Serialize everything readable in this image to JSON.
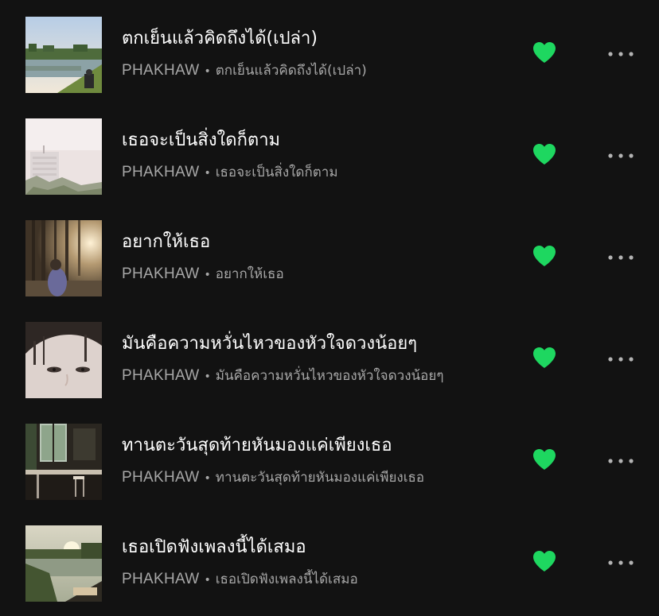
{
  "colors": {
    "background": "#121212",
    "title": "#ffffff",
    "subtitle": "#a7a7a7",
    "liked": "#1ed760",
    "more": "#b3b3b3"
  },
  "icons": {
    "like": "heart-filled-icon",
    "more": "more-options-icon"
  },
  "tracks": [
    {
      "title": "ตกเย็นแล้วคิดถึงได้(เปล่า)",
      "artist": "PHAKHAW",
      "separator": "•",
      "album": "ตกเย็นแล้วคิดถึงได้(เปล่า)",
      "liked": true
    },
    {
      "title": "เธอจะเป็นสิ่งใดก็ตาม",
      "artist": "PHAKHAW",
      "separator": "•",
      "album": "เธอจะเป็นสิ่งใดก็ตาม",
      "liked": true
    },
    {
      "title": "อยากให้เธอ",
      "artist": "PHAKHAW",
      "separator": "•",
      "album": "อยากให้เธอ",
      "liked": true
    },
    {
      "title": "มันคือความหวั่นไหวของหัวใจดวงน้อยๆ",
      "artist": "PHAKHAW",
      "separator": "•",
      "album": "มันคือความหวั่นไหวของหัวใจดวงน้อยๆ",
      "liked": true
    },
    {
      "title": "ทานตะวันสุดท้ายหันมองแค่เพียงเธอ",
      "artist": "PHAKHAW",
      "separator": "•",
      "album": "ทานตะวันสุดท้ายหันมองแค่เพียงเธอ",
      "liked": true
    },
    {
      "title": "เธอเปิดฟังเพลงนี้ได้เสมอ",
      "artist": "PHAKHAW",
      "separator": "•",
      "album": "เธอเปิดฟังเพลงนี้ได้เสมอ",
      "liked": true
    }
  ]
}
